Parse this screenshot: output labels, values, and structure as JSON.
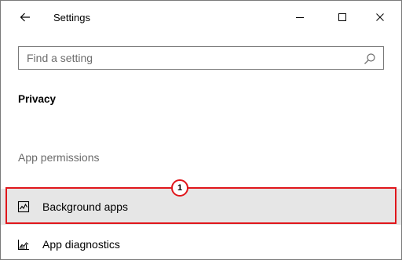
{
  "window": {
    "title": "Settings",
    "back_icon": "back-arrow-icon",
    "controls": [
      "minimize-icon",
      "maximize-icon",
      "close-icon"
    ]
  },
  "search": {
    "placeholder": "Find a setting",
    "value": "",
    "icon": "search-icon"
  },
  "page": {
    "title": "Privacy"
  },
  "app_permissions": {
    "label": "App permissions",
    "items": [
      {
        "label": "Background apps",
        "icon": "background-apps-icon",
        "state": "hovered"
      },
      {
        "label": "App diagnostics",
        "icon": "app-diagnostics-icon"
      }
    ]
  },
  "annotation": {
    "number": "1",
    "color": "#e0161b"
  }
}
